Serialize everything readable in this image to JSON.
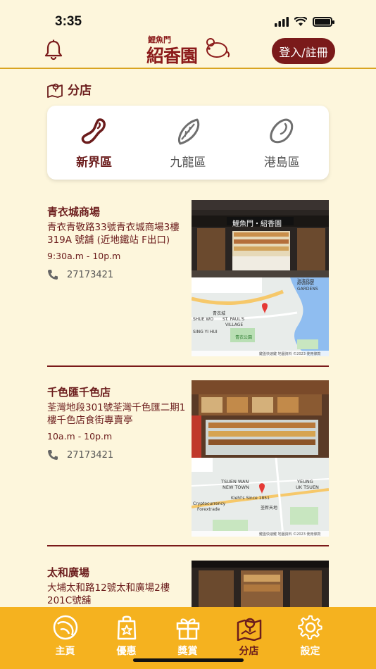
{
  "status": {
    "time": "3:35"
  },
  "header": {
    "logo_top": "鯉魚門",
    "logo_main": "紹香園",
    "login_label": "登入/註冊"
  },
  "section": {
    "title": "分店"
  },
  "regions": [
    {
      "label": "新界區",
      "active": true
    },
    {
      "label": "九龍區",
      "active": false
    },
    {
      "label": "港島區",
      "active": false
    }
  ],
  "branches": [
    {
      "name": "青衣城商場",
      "address": "青衣青敬路33號青衣城商場3樓319A 號舖 (近地鐵站 F出口)",
      "hours": "9:30a.m  -  10p.m",
      "phone": "27173421",
      "photo_sign": "鯉魚門・紹香園",
      "map": {
        "labels": [
          "RIVIERA",
          "GARDENS",
          "SHUE WO",
          "ST. PAUL'S",
          "VILLAGE",
          "青衣城",
          "青衣公園",
          "SING YI HUI",
          "海濱花園"
        ],
        "footer": "鍵盤快速鍵  地圖資料 ©2023  使用條款"
      }
    },
    {
      "name": "千色匯千色店",
      "address": "荃灣地段301號荃灣千色匯二期1樓千色店食街專賣亭",
      "hours": "10a.m  -  10p.m",
      "phone": "27173421",
      "photo_sign": "",
      "map": {
        "labels": [
          "TSUEN WAN",
          "NEW TOWN",
          "YEUNG",
          "UK TSUEN",
          "Kiehl's Since 1851",
          "Cryptocurrency",
          "Forextrade",
          "荃新天地"
        ],
        "footer": "鍵盤快速鍵  地圖資料 ©2023  使用條款"
      }
    },
    {
      "name": "太和廣場",
      "address": "大埔太和路12號太和廣場2樓201C號舖",
      "hours": "",
      "phone": "",
      "photo_sign": "",
      "map": {
        "labels": [],
        "footer": ""
      }
    }
  ],
  "tabs": [
    {
      "label": "主頁",
      "icon": "leaf-icon",
      "active": false
    },
    {
      "label": "優惠",
      "icon": "shopping-bag-icon",
      "active": false
    },
    {
      "label": "獎賞",
      "icon": "gift-icon",
      "active": false
    },
    {
      "label": "分店",
      "icon": "store-map-icon",
      "active": true
    },
    {
      "label": "設定",
      "icon": "gear-icon",
      "active": false
    }
  ],
  "colors": {
    "background": "#fdf6dc",
    "brand": "#7a1a1a",
    "tab_bar": "#f5b21f",
    "accent_line": "#d9a421"
  }
}
